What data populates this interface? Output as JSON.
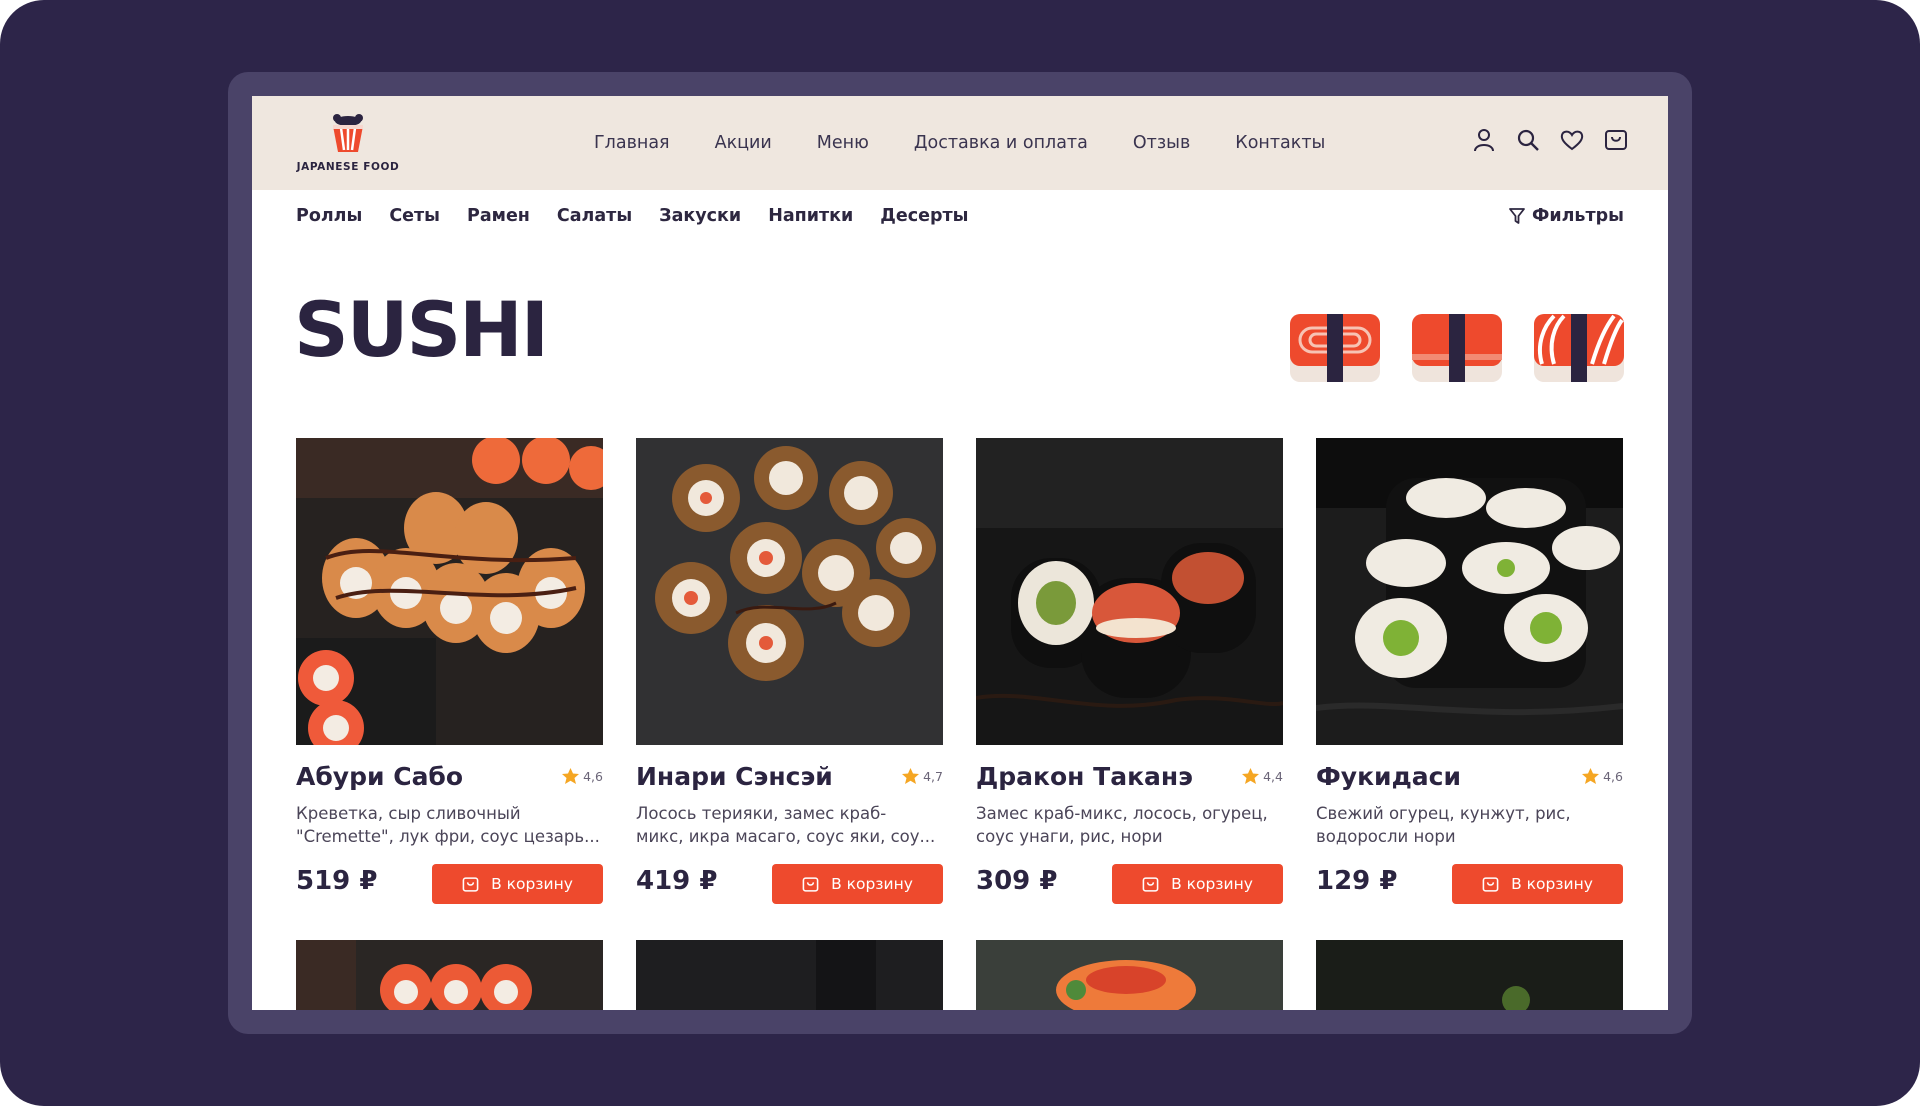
{
  "brand": {
    "name": "JAPANESE FOOD"
  },
  "main_nav": [
    "Главная",
    "Акции",
    "Меню",
    "Доставка и оплата",
    "Отзыв",
    "Контакты"
  ],
  "header_icons": [
    "user-icon",
    "search-icon",
    "heart-icon",
    "cart-icon"
  ],
  "categories": [
    "Роллы",
    "Сеты",
    "Рамен",
    "Салаты",
    "Закуски",
    "Напитки",
    "Десерты"
  ],
  "filters_label": "Фильтры",
  "page_title": "SUSHI",
  "type_icons": [
    "roll-type-icon",
    "nigiri-type-icon",
    "salmon-nigiri-type-icon"
  ],
  "products": [
    {
      "name": "Абури Сабо",
      "rating": "4,6",
      "desc1": "Креветка, сыр сливочный",
      "desc2": "\"Cremette\", лук фри, соус цезарь...",
      "price": "519 ₽",
      "cart_label": "В корзину"
    },
    {
      "name": "Инари Сэнсэй",
      "rating": "4,7",
      "desc1": "Лосось терияки, замес краб-",
      "desc2": "микс, икра масаго, соус яки, соу...",
      "price": "419 ₽",
      "cart_label": "В корзину"
    },
    {
      "name": "Дракон Таканэ",
      "rating": "4,4",
      "desc1": "Замес краб-микс, лосось, огурец,",
      "desc2": "соус унаги, рис, нори",
      "price": "309 ₽",
      "cart_label": "В корзину"
    },
    {
      "name": "Фукидаси",
      "rating": "4,6",
      "desc1": "Свежий огурец, кунжут, рис,",
      "desc2": "водоросли нори",
      "price": "129 ₽",
      "cart_label": "В корзину"
    }
  ],
  "colors": {
    "background": "#2d2549",
    "header": "#efe7df",
    "accent": "#ee4a2d",
    "text": "#2b2440",
    "star": "#f5a623"
  }
}
